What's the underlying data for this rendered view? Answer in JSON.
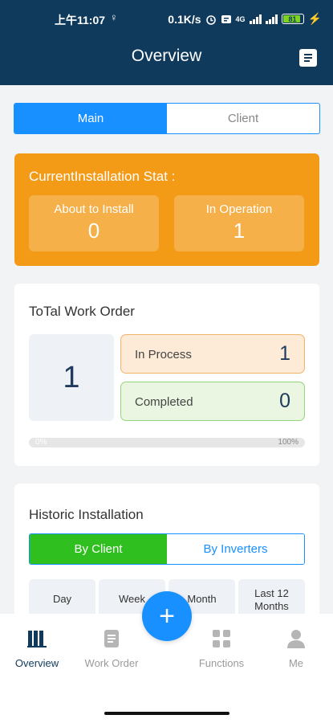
{
  "status_bar": {
    "time": "上午11:07",
    "location_glyph": "♀",
    "net_speed": "0.1K/s",
    "network": "4G",
    "battery": "81"
  },
  "header": {
    "title": "Overview"
  },
  "tabs": {
    "main": "Main",
    "client": "Client"
  },
  "installation": {
    "title": "CurrentInstallation Stat :",
    "about_to_install": {
      "label": "About to Install",
      "value": "0"
    },
    "in_operation": {
      "label": "In Operation",
      "value": "1"
    }
  },
  "work_order": {
    "title": "ToTal Work Order",
    "total": "1",
    "in_process": {
      "label": "In Process",
      "value": "1"
    },
    "completed": {
      "label": "Completed",
      "value": "0"
    },
    "progress_start_label": "0%",
    "progress_end_label": "100%",
    "progress_fraction": 0
  },
  "historic": {
    "title": "Historic Installation",
    "tab_client": "By Client",
    "tab_inverters": "By Inverters",
    "periods": [
      "Day",
      "Week",
      "Month",
      "Last 12 Months"
    ]
  },
  "tabbar": {
    "overview": "Overview",
    "work_order": "Work Order",
    "functions": "Functions",
    "me": "Me"
  },
  "fab_label": "+",
  "colors": {
    "header": "#0f3a5c",
    "accent_blue": "#1890ff",
    "install_orange": "#f39a17",
    "client_green": "#2fc01f"
  }
}
